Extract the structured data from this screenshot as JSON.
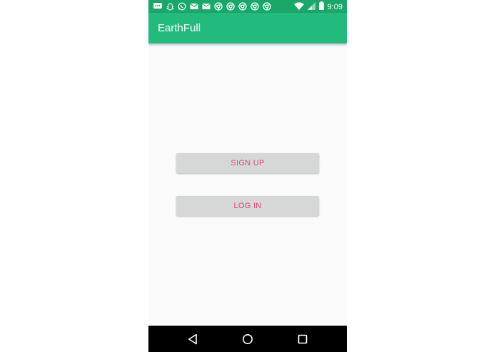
{
  "status_bar": {
    "time": "9:09",
    "notification_icons": [
      "chat-icon",
      "snapchat-icon",
      "whatsapp-icon",
      "gmail-icon",
      "email-icon",
      "chrome-icon",
      "chrome-icon",
      "chrome-icon",
      "chrome-icon",
      "chrome-icon"
    ],
    "system_icons": [
      "wifi-icon",
      "signal-icon",
      "battery-icon"
    ]
  },
  "app_bar": {
    "title": "EarthFull",
    "color": "#22bb7d"
  },
  "main": {
    "signup_label": "SIGN UP",
    "login_label": "LOG IN",
    "button_text_color": "#e5417a"
  },
  "nav_bar": {
    "buttons": [
      "back-icon",
      "home-icon",
      "recents-icon"
    ]
  }
}
